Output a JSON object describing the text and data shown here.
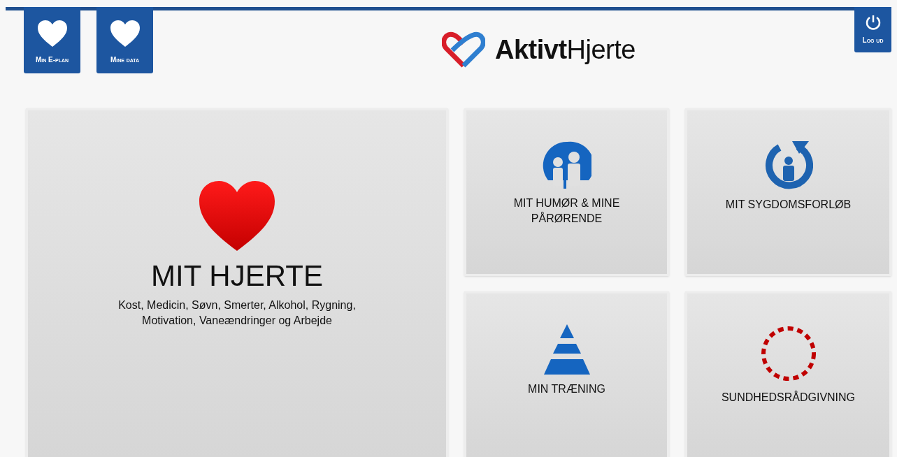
{
  "header_tiles": [
    {
      "label": "Min E-plan"
    },
    {
      "label": "Mine data"
    }
  ],
  "logout": {
    "label": "Log ud"
  },
  "logo": {
    "bold": "Aktivt",
    "regular": "Hjerte"
  },
  "main_tile": {
    "title": "MIT HJERTE",
    "subtitle": "Kost, Medicin, Søvn, Smerter, Alkohol, Rygning, Motivation, Vaneændringer og Arbejde"
  },
  "tiles": [
    {
      "kind": "people",
      "label": "MIT HUMØR & MINE PÅRØRENDE"
    },
    {
      "kind": "cycle",
      "label": "MIT SYGDOMSFORLØB"
    },
    {
      "kind": "pyramid",
      "label": "MIN TRÆNING"
    },
    {
      "kind": "ring",
      "label": "SUNDHEDSRÅDGIVNING"
    }
  ]
}
